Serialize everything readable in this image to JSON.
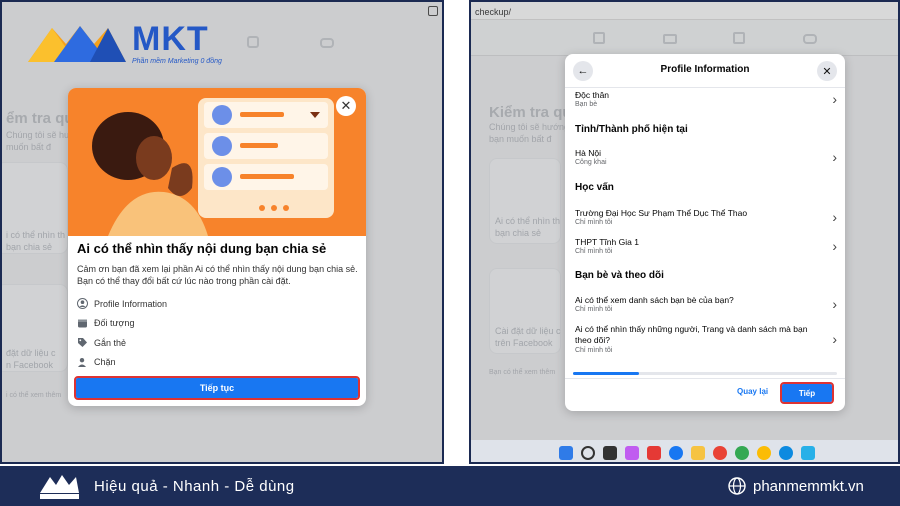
{
  "brand": {
    "logo_text": "MKT",
    "tagline": "Phần mềm Marketing 0 đồng",
    "slogan": "Hiệu quả - Nhanh - Dễ dùng",
    "website": "phanmemmkt.vn",
    "colors": {
      "blue": "#2458c6",
      "orange": "#f7a21b",
      "navy": "#1d2d58"
    }
  },
  "left_panel": {
    "background": {
      "title": "ểm tra quyề",
      "line1": "Chúng tôi sẽ hướng",
      "line2": "muốn bất đ",
      "card1_label": "i có thể nhìn th",
      "card1_label2": "bạn chia sẻ",
      "card2_label": "đặt dữ liệu c",
      "card2_label2": "n Facebook",
      "footer": "i có thể xem thêm"
    },
    "modal": {
      "title": "Ai có thể nhìn thấy nội dung bạn chia sẻ",
      "description": "Cảm ơn bạn đã xem lại phần Ai có thể nhìn thấy nội dung bạn chia sẻ. Bạn có thể thay đổi bất cứ lúc nào trong phần cài đặt.",
      "items": [
        {
          "label": "Profile Information",
          "icon": "profile-icon"
        },
        {
          "label": "Đối tượng",
          "icon": "audience-icon"
        },
        {
          "label": "Gắn thẻ",
          "icon": "tag-icon"
        },
        {
          "label": "Chặn",
          "icon": "block-icon"
        }
      ],
      "continue_button": "Tiếp tục"
    }
  },
  "right_panel": {
    "url": "checkup/",
    "background": {
      "title": "Kiểm tra quyề",
      "line1": "Chúng tôi sẽ hướng",
      "line2": "bạn muốn bất đ",
      "card1_label": "Ai có thể nhìn th",
      "card1_label2": "bạn chia sẻ",
      "card2_label": "Cài đặt dữ liệu c",
      "card2_label2": "trên Facebook",
      "footer": "Bạn có thể xem thêm"
    },
    "modal": {
      "title": "Profile Information",
      "top_row": {
        "title": "Độc thân",
        "sub": "Bạn bè"
      },
      "section_city": "Tỉnh/Thành phố hiện tại",
      "city_row": {
        "title": "Hà Nội",
        "sub": "Công khai"
      },
      "section_edu": "Học vấn",
      "edu_rows": [
        {
          "title": "Trường Đại Học Sư Phạm Thể Dục Thể Thao",
          "sub": "Chỉ mình tôi"
        },
        {
          "title": "THPT Tĩnh Gia 1",
          "sub": "Chỉ mình tôi"
        }
      ],
      "section_friends": "Bạn bè và theo dõi",
      "friend_rows": [
        {
          "title": "Ai có thể xem danh sách bạn bè của bạn?",
          "sub": "Chỉ mình tôi"
        },
        {
          "title": "Ai có thể nhìn thấy những người, Trang và danh sách mà bạn theo dõi?",
          "sub": "Chỉ mình tôi"
        }
      ],
      "progress": 0.25,
      "back_button": "Quay lại",
      "next_button": "Tiếp"
    }
  }
}
